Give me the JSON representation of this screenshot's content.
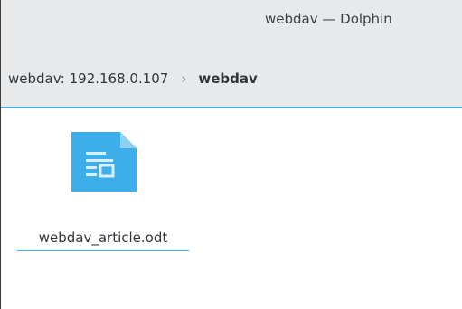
{
  "window": {
    "title": "webdav — Dolphin"
  },
  "breadcrumb": {
    "root": "webdav: 192.168.0.107",
    "separator": "›",
    "current": "webdav"
  },
  "files": [
    {
      "name": "webdav_article.odt",
      "icon": "document-icon"
    }
  ],
  "colors": {
    "accent": "#3daee9",
    "icon_blue": "#3daee9",
    "text": "#31363b",
    "chrome": "#e8e9ea"
  }
}
